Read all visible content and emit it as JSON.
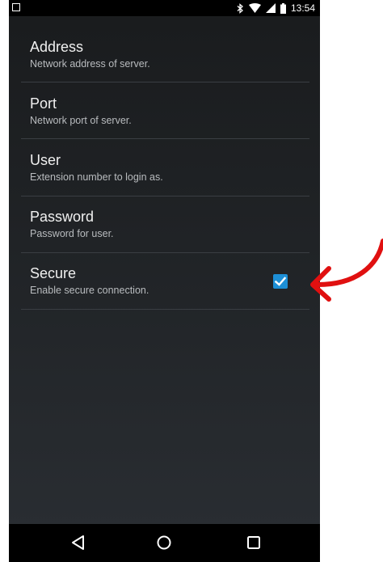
{
  "status_bar": {
    "time": "13:54",
    "icons": [
      "notification-icon",
      "bluetooth-icon",
      "wifi-icon",
      "signal-icon",
      "battery-icon"
    ]
  },
  "preferences": [
    {
      "title": "Address",
      "summary": "Network address of server."
    },
    {
      "title": "Port",
      "summary": "Network port of server."
    },
    {
      "title": "User",
      "summary": "Extension number to login as."
    },
    {
      "title": "Password",
      "summary": "Password for user."
    },
    {
      "title": "Secure",
      "summary": "Enable secure connection.",
      "checked": true
    }
  ],
  "nav_bar": {
    "icons": [
      "back-icon",
      "home-icon",
      "recents-icon"
    ]
  },
  "colors": {
    "accent": "#1d8fd6",
    "annotation": "#e01010",
    "background": "#202326"
  }
}
